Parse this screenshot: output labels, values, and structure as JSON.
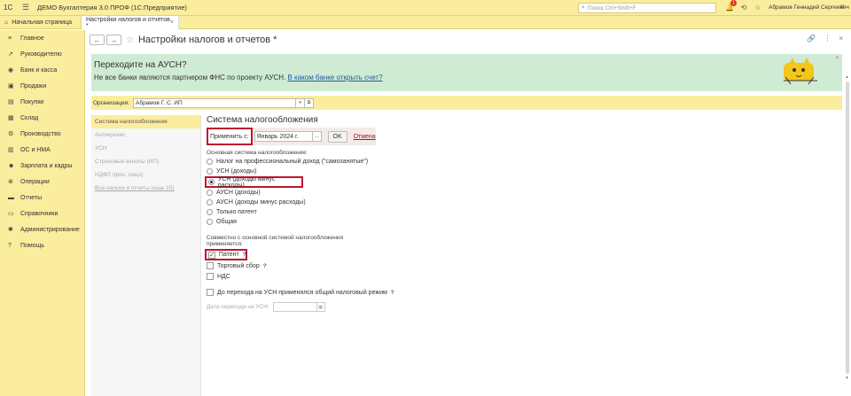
{
  "topbar": {
    "logo": "1С",
    "app_title": "ДЕМО Бухгалтерия 3.0 ПРОФ  (1С:Предприятие)",
    "search_placeholder": "Поиск Ctrl+Shift+F",
    "notification_count": "1",
    "user_name": "Абрамов Геннадий Сергеевич"
  },
  "tabs": {
    "home": "Начальная страница",
    "active": "Настройки налогов и отчетов *"
  },
  "sidebar": {
    "items": [
      {
        "label": "Главное",
        "icon": "≡"
      },
      {
        "label": "Руководителю",
        "icon": "↗"
      },
      {
        "label": "Банк и касса",
        "icon": "◉"
      },
      {
        "label": "Продажи",
        "icon": "▣"
      },
      {
        "label": "Покупки",
        "icon": "▤"
      },
      {
        "label": "Склад",
        "icon": "▦"
      },
      {
        "label": "Производство",
        "icon": "⚙"
      },
      {
        "label": "ОС и НМА",
        "icon": "▥"
      },
      {
        "label": "Зарплата и кадры",
        "icon": "☻"
      },
      {
        "label": "Операции",
        "icon": "⊗"
      },
      {
        "label": "Отчеты",
        "icon": "▬"
      },
      {
        "label": "Справочники",
        "icon": "▭"
      },
      {
        "label": "Администрирование",
        "icon": "✱"
      },
      {
        "label": "Помощь",
        "icon": "?"
      }
    ]
  },
  "form": {
    "title": "Настройки налогов и отчетов *"
  },
  "banner": {
    "title": "Переходите на АУСН?",
    "text": "Не все банки являются партнером ФНС по проекту АУСН.",
    "link": "В каком банке открыть счет?"
  },
  "org": {
    "label": "Организация:",
    "value": "Абрамов Г. С. ИП"
  },
  "leftnav": {
    "items": [
      {
        "label": "Система налогообложения"
      },
      {
        "label": "Антикризис"
      },
      {
        "label": "УСН"
      },
      {
        "label": "Страховые взносы (ИП)"
      },
      {
        "label": "НДФЛ (физ. лицо)"
      },
      {
        "label": "Все налоги и отчеты (еще 15)"
      }
    ]
  },
  "tax": {
    "section_title": "Система налогообложения",
    "apply_label": "Применить с:",
    "apply_date": "Январь 2024 г.",
    "ok": "OK",
    "cancel": "Отмена",
    "main_label": "Основная система налогообложения:",
    "options": [
      "Налог на профессиональный доход (\"самозанятые\")",
      "УСН (доходы)",
      "УСН (доходы минус расходы)",
      "АУСН (доходы)",
      "АУСН (доходы минус расходы)",
      "Только патент",
      "Общая"
    ],
    "combined_label": "Совместно с основной системой налогообложения применяется:",
    "checks": [
      "Патент",
      "Торговый сбор",
      "НДС"
    ],
    "prev_general": "До перехода на УСН применялся общий налоговый режим",
    "date_label": "Дата перехода на УСН:",
    "date_placeholder": ". .",
    "q": "?"
  }
}
